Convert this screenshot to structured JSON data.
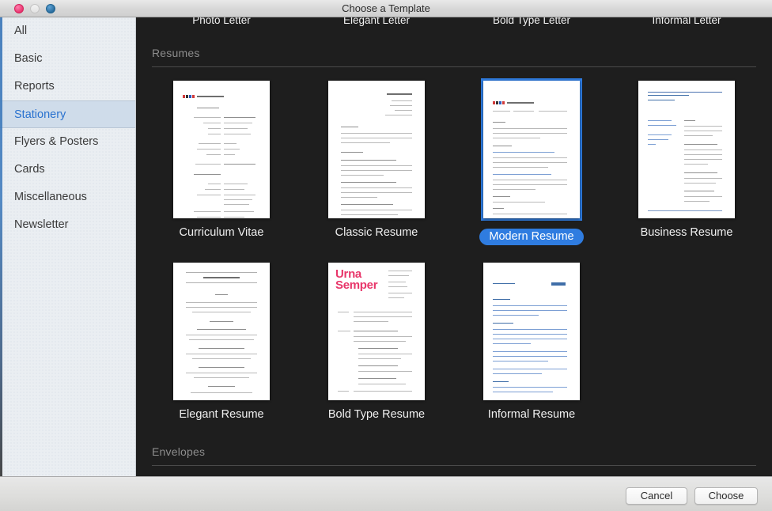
{
  "window": {
    "title": "Choose a Template",
    "traffic_lights": [
      "close-button",
      "minimize-button",
      "zoom-button"
    ]
  },
  "sidebar": {
    "items": [
      {
        "label": "All",
        "selected": false
      },
      {
        "label": "Basic",
        "selected": false
      },
      {
        "label": "Reports",
        "selected": false
      },
      {
        "label": "Stationery",
        "selected": true
      },
      {
        "label": "Flyers & Posters",
        "selected": false
      },
      {
        "label": "Cards",
        "selected": false
      },
      {
        "label": "Miscellaneous",
        "selected": false
      },
      {
        "label": "Newsletter",
        "selected": false
      }
    ]
  },
  "content": {
    "clipped_top_row": [
      "Photo Letter",
      "Elegant Letter",
      "Bold Type Letter",
      "Informal Letter"
    ],
    "sections": [
      {
        "title": "Resumes"
      },
      {
        "title": "Envelopes"
      }
    ],
    "templates_row1": [
      {
        "label": "Curriculum Vitae",
        "selected": false,
        "style": "cv"
      },
      {
        "label": "Classic Resume",
        "selected": false,
        "style": "classic"
      },
      {
        "label": "Modern Resume",
        "selected": true,
        "style": "modern"
      },
      {
        "label": "Business Resume",
        "selected": false,
        "style": "business"
      }
    ],
    "templates_row2": [
      {
        "label": "Elegant Resume",
        "selected": false,
        "style": "elegant"
      },
      {
        "label": "Bold Type Resume",
        "selected": false,
        "style": "bold"
      },
      {
        "label": "Informal Resume",
        "selected": false,
        "style": "informal"
      }
    ],
    "bold_headline": "Urna\nSemper"
  },
  "footer": {
    "cancel_label": "Cancel",
    "choose_label": "Choose"
  },
  "colors": {
    "accent": "#2f7ce0",
    "selected_sidebar_text": "#2a72cf",
    "sidebar_bg": "#eaeef2",
    "content_bg": "#1e1e1e",
    "section_header": "#8d8d8d",
    "bold_type_pink": "#e8366a"
  }
}
